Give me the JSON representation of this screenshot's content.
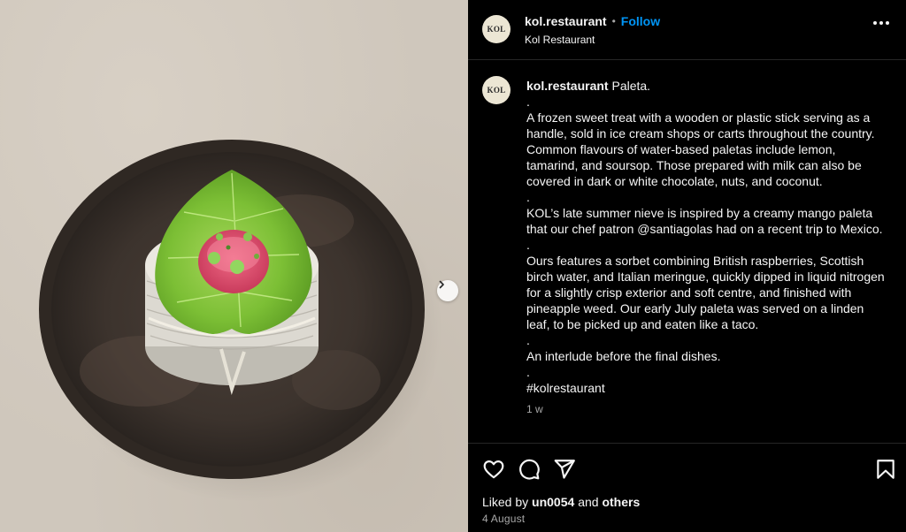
{
  "post": {
    "media": {
      "image_alt": "paleta on linden leaf on dark ceramic plate",
      "next_icon": "chevron-right-icon"
    },
    "header": {
      "avatar_text": "KOL",
      "username": "kol.restaurant",
      "separator": "•",
      "follow_label": "Follow",
      "subtitle": "Kol Restaurant",
      "more_icon": "more-horizontal-icon"
    },
    "caption": {
      "avatar_text": "KOL",
      "username": "kol.restaurant",
      "title": "Paleta.",
      "lines": [
        ".",
        "A frozen sweet treat with a wooden or plastic stick serving as a handle, sold in ice cream shops or carts throughout the country. Common flavours of water-based paletas include lemon, tamarind, and soursop. Those prepared with milk can also be covered in dark or white chocolate, nuts, and coconut.",
        ".",
        "KOL’s late summer nieve is inspired by a creamy mango paleta that our chef patron @santiagolas had on a recent trip to Mexico.",
        ".",
        "Ours features a sorbet combining British raspberries, Scottish birch water, and Italian meringue, quickly dipped in liquid nitrogen for a slightly crisp exterior and soft centre, and finished with pineapple weed. Our early July paleta was served on a linden leaf, to be picked up and eaten like a taco.",
        ".",
        "An interlude before the final dishes.",
        ".",
        "#kolrestaurant"
      ],
      "time_ago": "1 w"
    },
    "actions": {
      "icons": [
        "heart-icon",
        "comment-icon",
        "share-icon",
        "bookmark-icon"
      ],
      "liked_by_prefix": "Liked by",
      "liked_by_user": "un0054",
      "liked_by_and": "and",
      "liked_by_others": "others",
      "date": "4 August"
    }
  }
}
